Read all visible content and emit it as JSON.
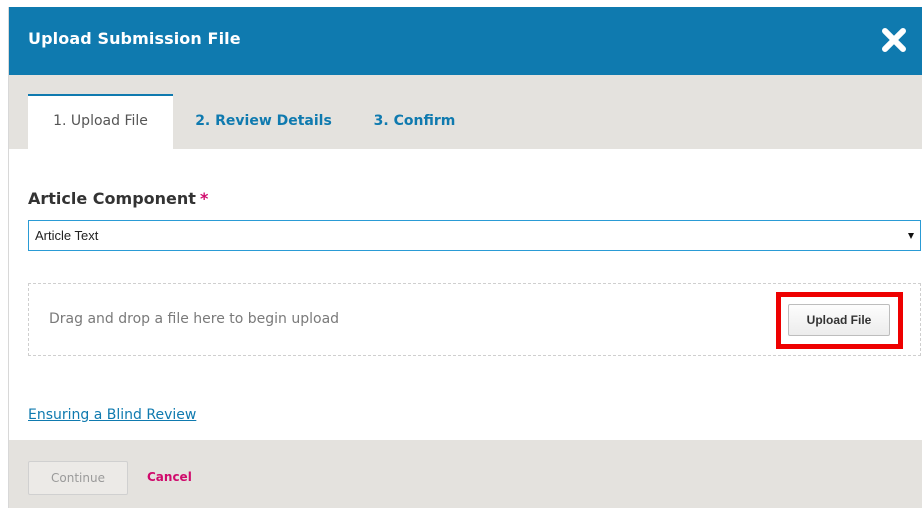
{
  "modal": {
    "title": "Upload Submission File",
    "close_icon": "close-x-icon"
  },
  "tabs": [
    {
      "label": "1. Upload File",
      "active": true
    },
    {
      "label": "2. Review Details",
      "active": false
    },
    {
      "label": "3. Confirm",
      "active": false
    }
  ],
  "form": {
    "component_label": "Article Component",
    "required_marker": "*",
    "component_value": "Article Text",
    "dropzone_text": "Drag and drop a file here to begin upload",
    "upload_button_label": "Upload File",
    "blind_review_link": "Ensuring a Blind Review"
  },
  "footer": {
    "continue_label": "Continue",
    "continue_disabled": true,
    "cancel_label": "Cancel"
  },
  "colors": {
    "header_bg": "#0f7aaf",
    "tab_bar_bg": "#e4e2de",
    "link": "#0f7aaf",
    "required": "#d00a6c",
    "highlight": "#ee0000"
  }
}
